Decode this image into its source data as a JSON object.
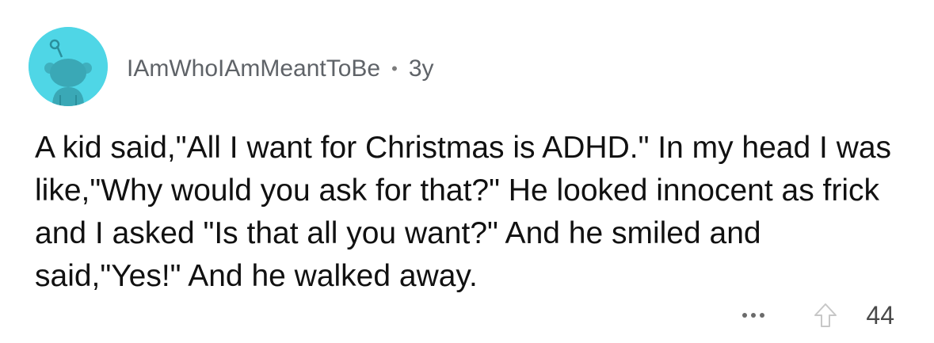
{
  "comment": {
    "author": "IAmWhoIAmMeantToBe",
    "separator": "•",
    "age": "3y",
    "avatar_icon": "snoo-avatar-icon",
    "avatar_color": "#4fd6e6",
    "body": "A kid said,\"All I want for Christmas is ADHD.\" In my head I was like,\"Why would you ask for that?\" He looked innocent as frick and I asked \"Is that all you want?\" And he smiled and said,\"Yes!\" And he walked away.",
    "actions": {
      "more_icon": "more-dots-icon",
      "upvote_icon": "upvote-arrow-icon",
      "score": "44"
    }
  }
}
